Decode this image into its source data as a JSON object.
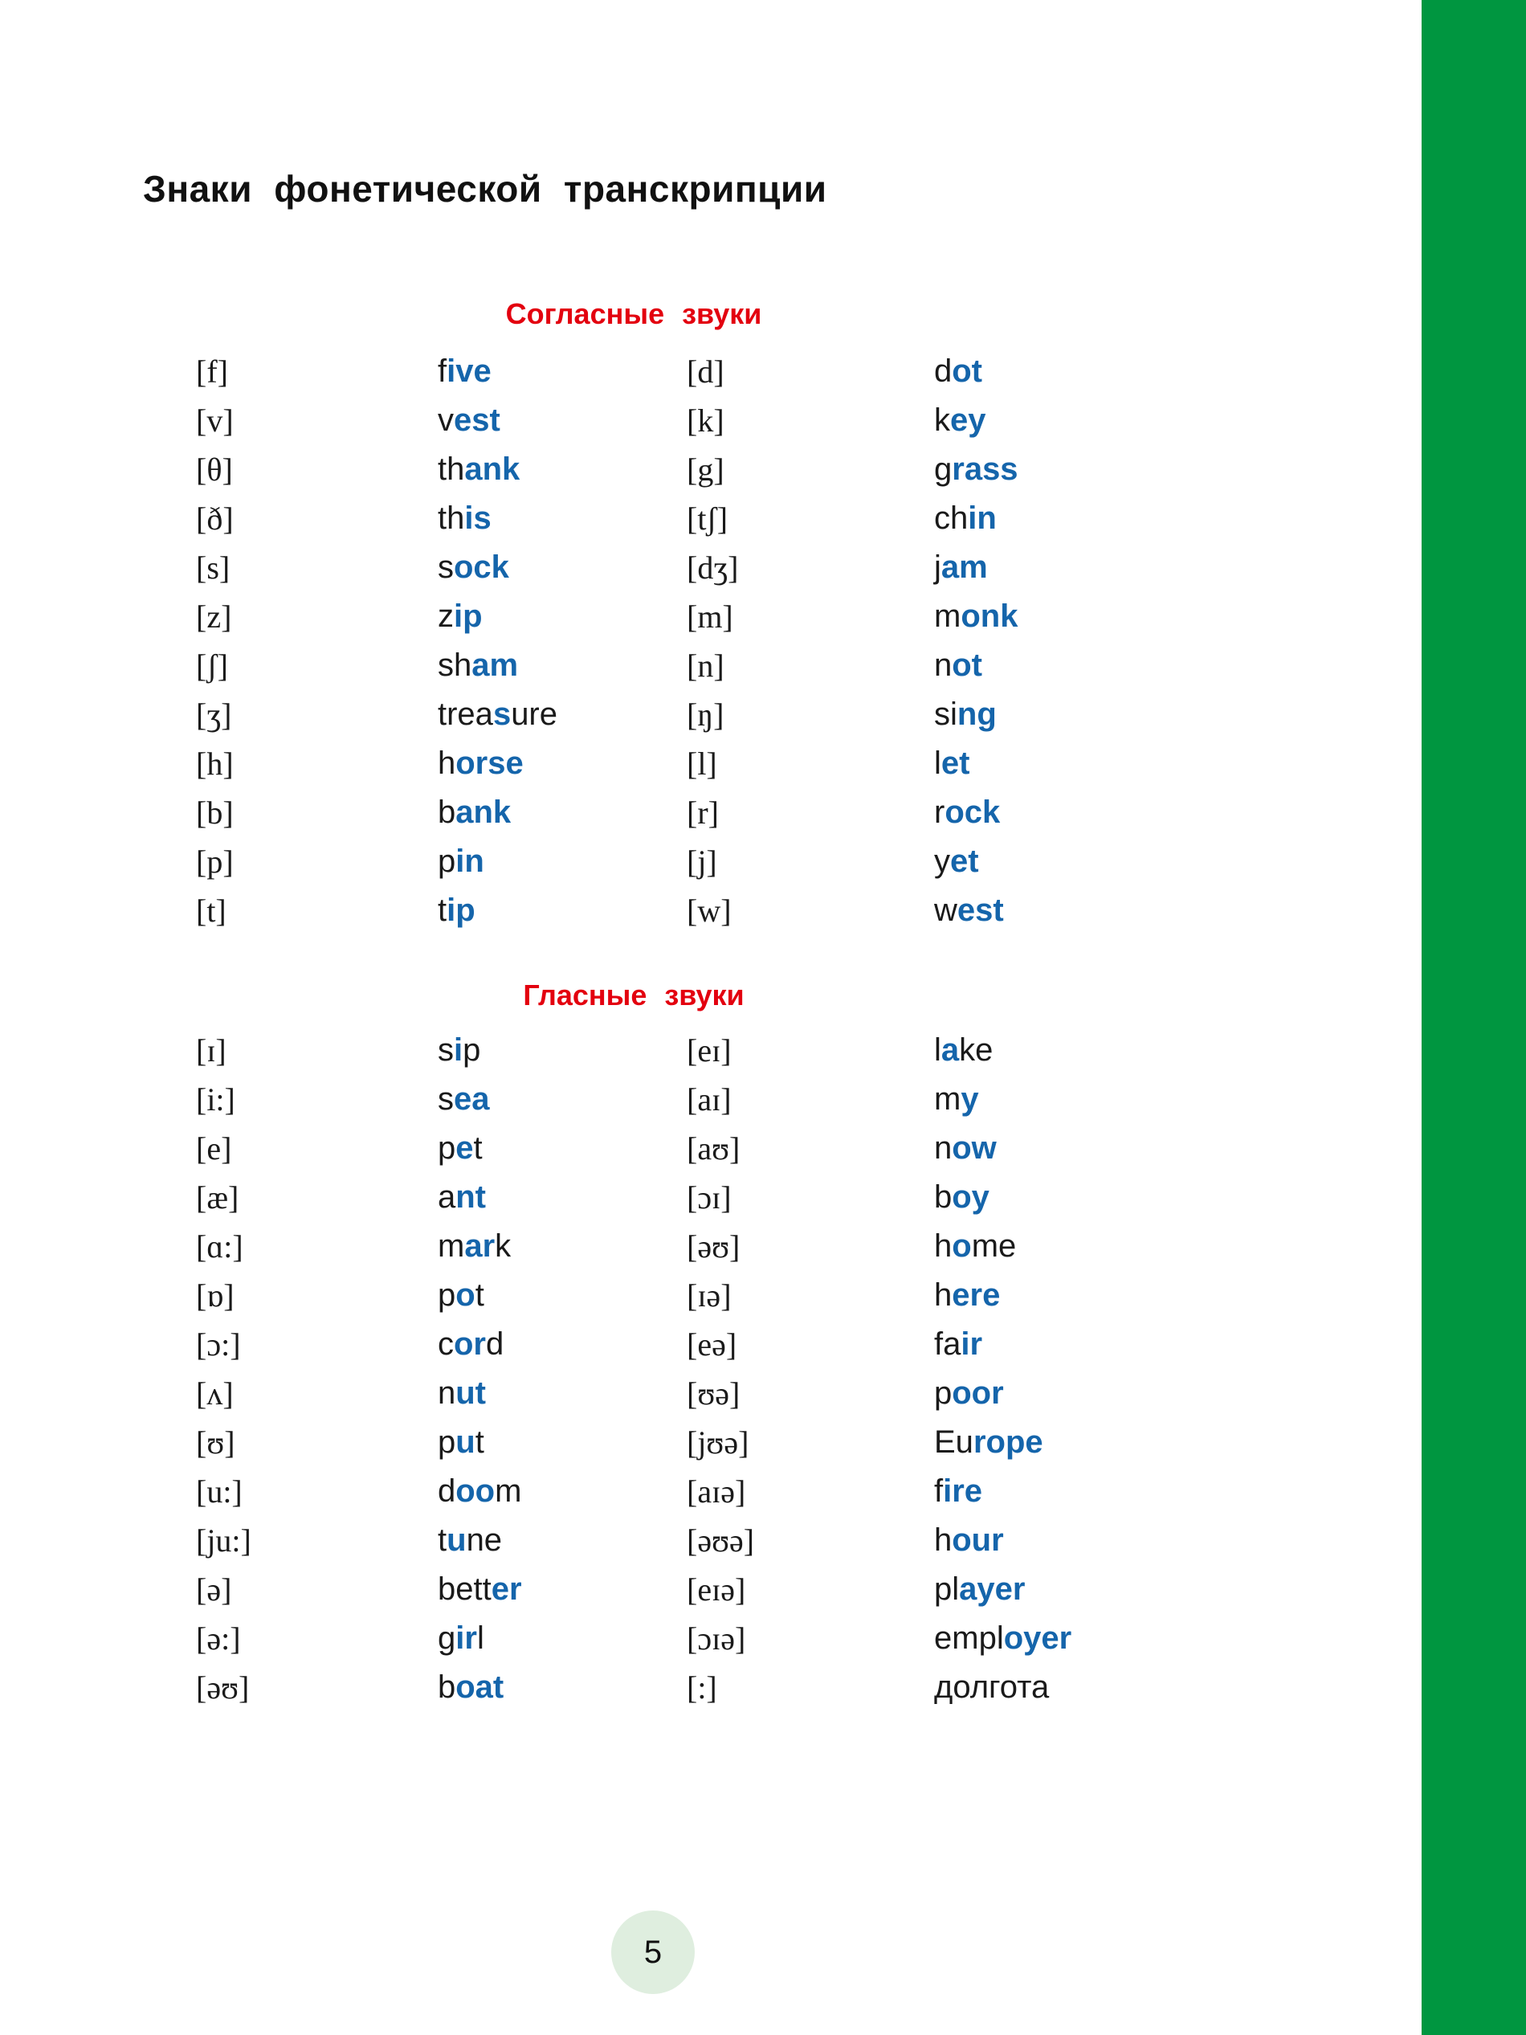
{
  "page": {
    "title": "Знаки  фонетической  транскрипции",
    "page_number": "5",
    "accent_red": "#e3000f",
    "accent_blue": "#1565ab",
    "edge_green": "#009640",
    "page_badge_bg": "#dfeedf"
  },
  "sections": [
    {
      "id": "consonants",
      "heading": "Согласные  звуки",
      "rows": [
        {
          "ipa_left": "[f]",
          "word_left": [
            "f",
            "ive"
          ],
          "ipa_right": "[d]",
          "word_right": [
            "d",
            "ot"
          ]
        },
        {
          "ipa_left": "[v]",
          "word_left": [
            "v",
            "est"
          ],
          "ipa_right": "[k]",
          "word_right": [
            "k",
            "ey"
          ]
        },
        {
          "ipa_left": "[θ]",
          "word_left": [
            "th",
            "ank"
          ],
          "ipa_right": "[g]",
          "word_right": [
            "g",
            "rass"
          ]
        },
        {
          "ipa_left": "[ð]",
          "word_left": [
            "th",
            "is"
          ],
          "ipa_right": "[tʃ]",
          "word_right": [
            "ch",
            "in"
          ]
        },
        {
          "ipa_left": "[s]",
          "word_left": [
            "s",
            "ock"
          ],
          "ipa_right": "[dʒ]",
          "word_right": [
            "j",
            "am"
          ]
        },
        {
          "ipa_left": "[z]",
          "word_left": [
            "z",
            "ip"
          ],
          "ipa_right": "[m]",
          "word_right": [
            "m",
            "onk"
          ]
        },
        {
          "ipa_left": "[ʃ]",
          "word_left": [
            "sh",
            "am"
          ],
          "ipa_right": "[n]",
          "word_right": [
            "n",
            "ot"
          ]
        },
        {
          "ipa_left": "[ʒ]",
          "word_left": [
            "trea",
            "s",
            "ure"
          ],
          "ipa_right": "[ŋ]",
          "word_right": [
            "si",
            "ng"
          ]
        },
        {
          "ipa_left": "[h]",
          "word_left": [
            "h",
            "orse"
          ],
          "ipa_right": "[l]",
          "word_right": [
            "l",
            "et"
          ]
        },
        {
          "ipa_left": "[b]",
          "word_left": [
            "b",
            "ank"
          ],
          "ipa_right": "[r]",
          "word_right": [
            "r",
            "ock"
          ]
        },
        {
          "ipa_left": "[p]",
          "word_left": [
            "p",
            "in"
          ],
          "ipa_right": "[j]",
          "word_right": [
            "y",
            "et"
          ]
        },
        {
          "ipa_left": "[t]",
          "word_left": [
            "t",
            "ip"
          ],
          "ipa_right": "[w]",
          "word_right": [
            "w",
            "est"
          ]
        }
      ]
    },
    {
      "id": "vowels",
      "heading": "Гласные  звуки",
      "rows": [
        {
          "ipa_left": "[ɪ]",
          "word_left": [
            "s",
            "i",
            "p"
          ],
          "ipa_right": "[eɪ]",
          "word_right": [
            "l",
            "a",
            "ke"
          ]
        },
        {
          "ipa_left": "[i:]",
          "word_left": [
            "s",
            "ea"
          ],
          "ipa_right": "[aɪ]",
          "word_right": [
            "m",
            "y"
          ]
        },
        {
          "ipa_left": "[e]",
          "word_left": [
            "p",
            "e",
            "t"
          ],
          "ipa_right": "[aʊ]",
          "word_right": [
            "n",
            "ow"
          ]
        },
        {
          "ipa_left": "[æ]",
          "word_left": [
            "a",
            "nt"
          ],
          "ipa_right": "[ɔɪ]",
          "word_right": [
            "b",
            "oy"
          ]
        },
        {
          "ipa_left": "[ɑ:]",
          "word_left": [
            "m",
            "ar",
            "k"
          ],
          "ipa_right": "[əʊ]",
          "word_right": [
            "h",
            "o",
            "me"
          ]
        },
        {
          "ipa_left": "[ɒ]",
          "word_left": [
            "p",
            "o",
            "t"
          ],
          "ipa_right": "[ɪə]",
          "word_right": [
            "h",
            "ere"
          ]
        },
        {
          "ipa_left": "[ɔ:]",
          "word_left": [
            "c",
            "or",
            "d"
          ],
          "ipa_right": "[eə]",
          "word_right": [
            "fa",
            "ir"
          ]
        },
        {
          "ipa_left": "[ʌ]",
          "word_left": [
            "n",
            "ut"
          ],
          "ipa_right": "[ʊə]",
          "word_right": [
            "p",
            "oor"
          ]
        },
        {
          "ipa_left": "[ʊ]",
          "word_left": [
            "p",
            "u",
            "t"
          ],
          "ipa_right": "[jʊə]",
          "word_right": [
            "Eu",
            "rope"
          ]
        },
        {
          "ipa_left": "[u:]",
          "word_left": [
            "d",
            "oo",
            "m"
          ],
          "ipa_right": "[aɪə]",
          "word_right": [
            "f",
            "ire"
          ]
        },
        {
          "ipa_left": "[ju:]",
          "word_left": [
            "t",
            "u",
            "ne"
          ],
          "ipa_right": "[əʊə]",
          "word_right": [
            "h",
            "our"
          ]
        },
        {
          "ipa_left": "[ə]",
          "word_left": [
            "bett",
            "er"
          ],
          "ipa_right": "[eɪə]",
          "word_right": [
            "pl",
            "ayer"
          ]
        },
        {
          "ipa_left": "[ə:]",
          "word_left": [
            "g",
            "ir",
            "l"
          ],
          "ipa_right": "[ɔɪə]",
          "word_right": [
            "empl",
            "oyer"
          ]
        },
        {
          "ipa_left": "[əʊ]",
          "word_left": [
            "b",
            "oat"
          ],
          "ipa_right": "[:]",
          "word_right": [
            "долгота"
          ]
        }
      ]
    }
  ]
}
